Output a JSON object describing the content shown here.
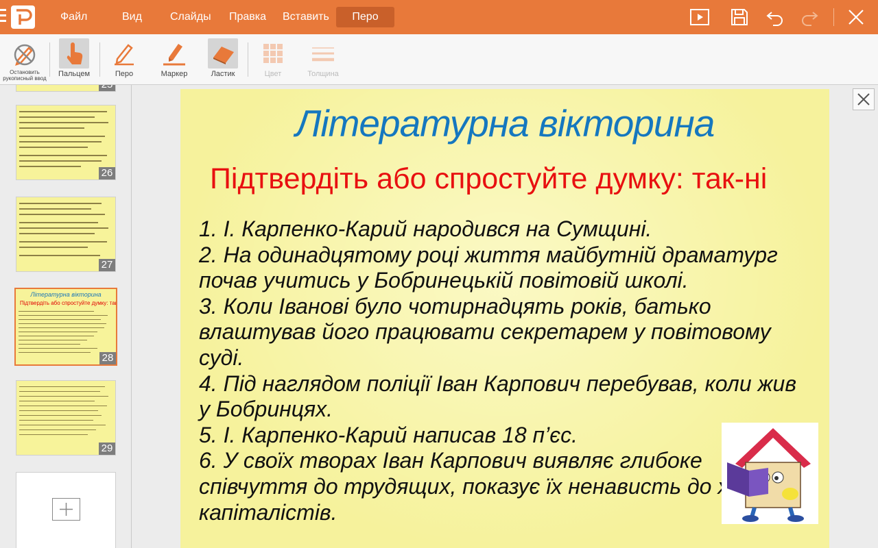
{
  "menubar": {
    "items": [
      "Файл",
      "Вид",
      "Слайды",
      "Правка",
      "Вставить",
      "Перо"
    ],
    "active": "Перо"
  },
  "ribbon": {
    "tools": {
      "stop_ink": "Остановить рукописный ввод",
      "finger": "Пальцем",
      "pen": "Перо",
      "marker": "Маркер",
      "eraser": "Ластик",
      "color": "Цвет",
      "thickness": "Толщина"
    }
  },
  "sidebar": {
    "slides": [
      {
        "number": "25"
      },
      {
        "number": "26"
      },
      {
        "number": "27"
      },
      {
        "number": "28",
        "title": "Літературна вікторина",
        "subtitle": "Підтвердіть або спростуйте думку: так-ні"
      },
      {
        "number": "29"
      }
    ]
  },
  "slide": {
    "title": "Літературна вікторина",
    "subtitle": "Підтвердіть або спростуйте думку: так-ні",
    "items": [
      "1. І. Карпенко-Карий народився на Сумщині.",
      "2. На одинадцятому році життя майбутній драматург почав учитись у Бобринецькій повітовій школі.",
      "3. Коли Іванові було чотирнадцять років, батько влаштував його працювати секретарем у повітовому суді.",
      "4. Під наглядом поліції Іван Карпович перебував, коли жив у Бобринцях.",
      "5. І. Карпенко-Карий написав 18 п’єс.",
      "6. У своїх творах Іван Карпович виявляє глибоке співчуття до трудящих, показує їх ненависть до хижаків-капіталістів."
    ]
  },
  "colors": {
    "accent": "#e8793a",
    "title": "#1577bf",
    "subtitle": "#e81010",
    "slide_bg": "#f6f29c"
  }
}
